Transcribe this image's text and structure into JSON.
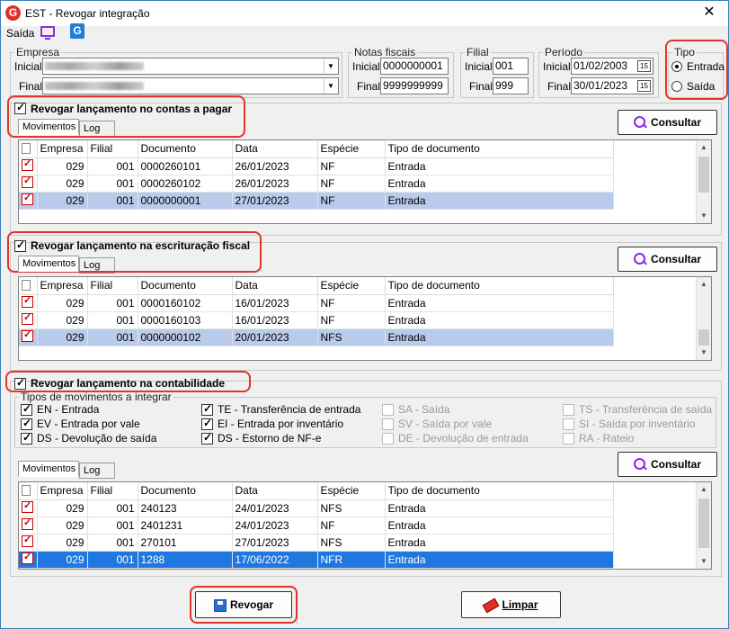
{
  "window": {
    "title": "EST - Revogar integração",
    "logo": "G",
    "close": "✕"
  },
  "toolbar": {
    "saida": "Saída",
    "g_icon": "G"
  },
  "empresa": {
    "legend": "Empresa",
    "inicial_label": "Inicial",
    "final_label": "Final"
  },
  "notas": {
    "legend": "Notas fiscais",
    "inicial_label": "Inicial",
    "final_label": "Final",
    "inicial": "0000000001",
    "final": "9999999999"
  },
  "filial": {
    "legend": "Filial",
    "inicial_label": "Inicial",
    "final_label": "Final",
    "inicial": "001",
    "final": "999"
  },
  "periodo": {
    "legend": "Período",
    "inicial_label": "Inicial",
    "final_label": "Final",
    "inicial": "01/02/2003",
    "final": "30/01/2023",
    "cal": "15"
  },
  "tipo": {
    "legend": "Tipo",
    "entrada": "Entrada",
    "saida": "Saída"
  },
  "columns": [
    "Empresa",
    "Filial",
    "Documento",
    "Data",
    "Espécie",
    "Tipo de documento"
  ],
  "sec1": {
    "title": "Revogar lançamento no contas a pagar",
    "tab_mov": "Movimentos",
    "tab_log": "Log",
    "consultar": "Consultar",
    "rows": [
      [
        "029",
        "001",
        "0000260101",
        "26/01/2023",
        "NF",
        "Entrada"
      ],
      [
        "029",
        "001",
        "0000260102",
        "26/01/2023",
        "NF",
        "Entrada"
      ],
      [
        "029",
        "001",
        "0000000001",
        "27/01/2023",
        "NF",
        "Entrada"
      ]
    ]
  },
  "sec2": {
    "title": "Revogar lançamento na escrituração fiscal",
    "tab_mov": "Movimentos",
    "tab_log": "Log",
    "consultar": "Consultar",
    "rows": [
      [
        "029",
        "001",
        "0000160102",
        "16/01/2023",
        "NF",
        "Entrada"
      ],
      [
        "029",
        "001",
        "0000160103",
        "16/01/2023",
        "NF",
        "Entrada"
      ],
      [
        "029",
        "001",
        "0000000102",
        "20/01/2023",
        "NFS",
        "Entrada"
      ]
    ]
  },
  "sec3": {
    "title": "Revogar lançamento na contabilidade",
    "tipos_legend": "Tipos de movimentos a integrar",
    "tipos": [
      {
        "label": "EN - Entrada",
        "checked": true,
        "enabled": true
      },
      {
        "label": "EV - Entrada por vale",
        "checked": true,
        "enabled": true
      },
      {
        "label": "DS - Devolução de saída",
        "checked": true,
        "enabled": true
      },
      {
        "label": "TE - Transferência de entrada",
        "checked": true,
        "enabled": true
      },
      {
        "label": "EI - Entrada por inventário",
        "checked": true,
        "enabled": true
      },
      {
        "label": "DS - Estorno de NF-e",
        "checked": true,
        "enabled": true
      },
      {
        "label": "SA - Saída",
        "checked": false,
        "enabled": false
      },
      {
        "label": "SV - Saída por vale",
        "checked": false,
        "enabled": false
      },
      {
        "label": "DE - Devolução de entrada",
        "checked": false,
        "enabled": false
      },
      {
        "label": "TS - Transferência de saída",
        "checked": false,
        "enabled": false
      },
      {
        "label": "SI - Saída por inventário",
        "checked": false,
        "enabled": false
      },
      {
        "label": "RA - Rateio",
        "checked": false,
        "enabled": false
      }
    ],
    "tab_mov": "Movimentos",
    "tab_log": "Log",
    "consultar": "Consultar",
    "rows": [
      [
        "029",
        "001",
        "240123",
        "24/01/2023",
        "NFS",
        "Entrada"
      ],
      [
        "029",
        "001",
        "2401231",
        "24/01/2023",
        "NF",
        "Entrada"
      ],
      [
        "029",
        "001",
        "270101",
        "27/01/2023",
        "NFS",
        "Entrada"
      ],
      [
        "029",
        "001",
        "1288",
        "17/06/2022",
        "NFR",
        "Entrada"
      ]
    ]
  },
  "footer": {
    "revogar": "Revogar",
    "limpar": "Limpar"
  },
  "colors": {
    "highlight": "#e0342c",
    "selected_row": "#b9cbea",
    "active_row": "#1e78e0",
    "icon_purple": "#8a2be2"
  }
}
